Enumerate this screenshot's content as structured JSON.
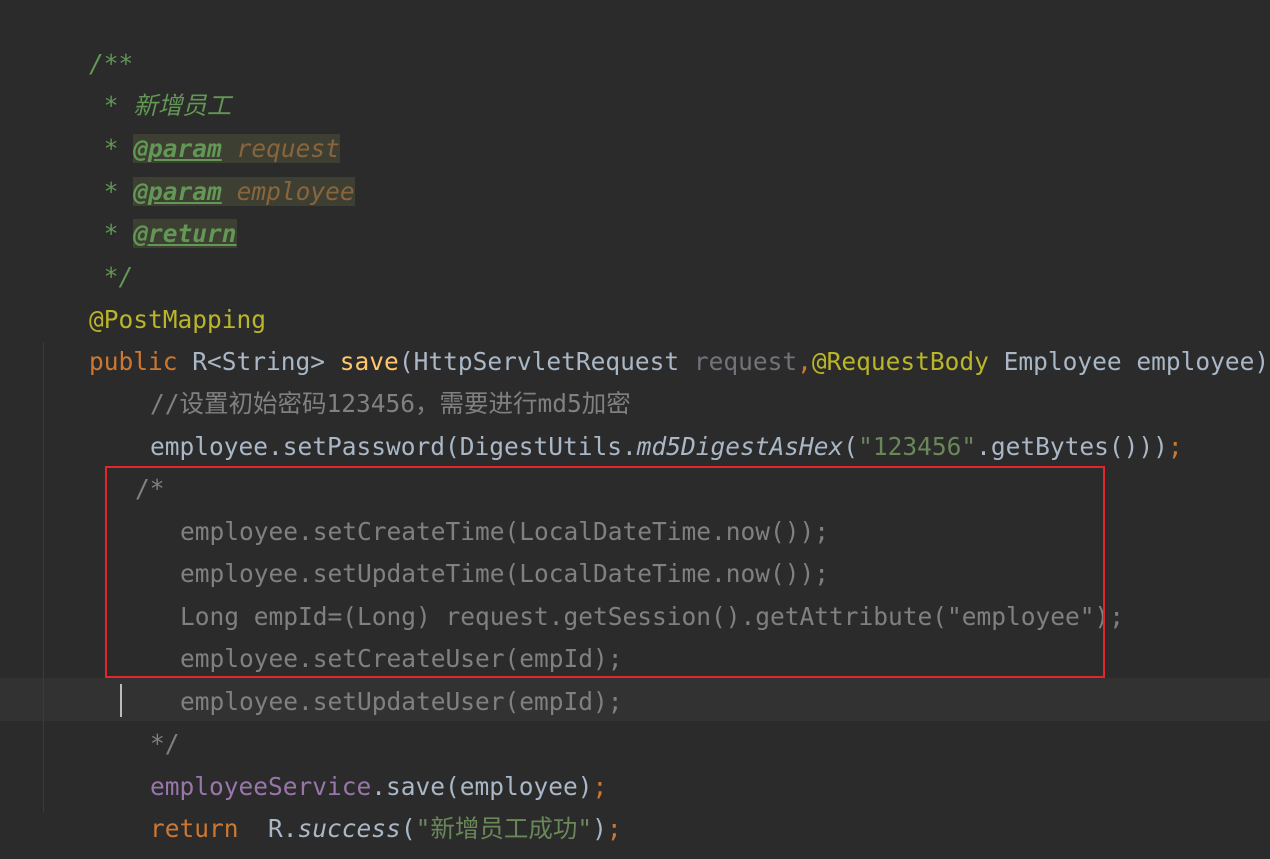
{
  "editor": {
    "theme_colors": {
      "background": "#2b2b2b",
      "doc_comment": "#629755",
      "keyword": "#cc7832",
      "annotation": "#bbb529",
      "method_decl": "#ffc66d",
      "string": "#6a8759",
      "field": "#9876aa",
      "comment": "#808080",
      "highlight_box": "#e1262d"
    },
    "lines": {
      "l1": "/**",
      "l2_star": " * ",
      "l2_text": "新增员工",
      "l3_star": " * ",
      "l3_tag": "@param",
      "l3_val": "request",
      "l4_star": " * ",
      "l4_tag": "@param",
      "l4_val": "employee",
      "l5_star": " * ",
      "l5_tag": "@return",
      "l6": " */",
      "l7": "@PostMapping",
      "l8_kw": "public",
      "l8_type": " R<String> ",
      "l8_fn": "save",
      "l8_p1": "(HttpServletRequest ",
      "l8_unused": "request",
      "l8_comma": ",",
      "l8_annot": "@RequestBody",
      "l8_rest": " Employee employee){",
      "l9": "//设置初始密码123456，需要进行md5加密",
      "l10_a": "employee.setPassword(DigestUtils.",
      "l10_static": "md5DigestAsHex",
      "l10_b": "(",
      "l10_str": "\"123456\"",
      "l10_c": ".getBytes()))",
      "l10_semi": ";",
      "l11": "/*",
      "l12": "employee.setCreateTime(LocalDateTime.now());",
      "l13": "employee.setUpdateTime(LocalDateTime.now());",
      "l14": "Long empId=(Long) request.getSession().getAttribute(\"employee\");",
      "l15": "employee.setCreateUser(empId);",
      "l16": "employee.setUpdateUser(empId);",
      "l17": "*/",
      "l18_field": "employeeService",
      "l18_rest": ".save(employee)",
      "l18_semi": ";",
      "l19_kw": "return",
      "l19_a": "  R.",
      "l19_static": "success",
      "l19_b": "(",
      "l19_str": "\"新增员工成功\"",
      "l19_c": ")",
      "l19_semi": ";",
      "l20": "}"
    }
  }
}
